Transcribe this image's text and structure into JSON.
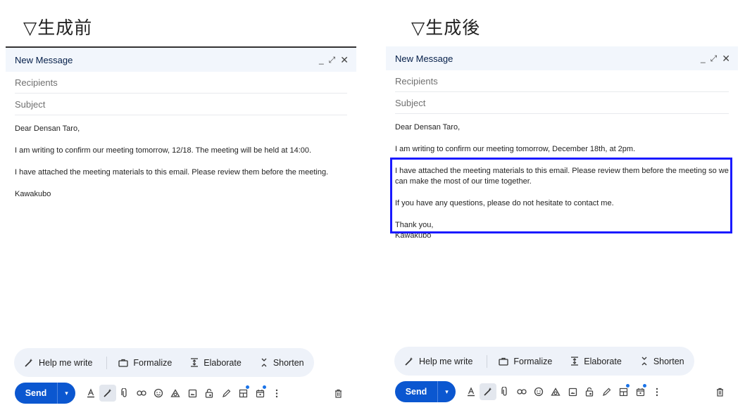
{
  "captions": {
    "before": "▽生成前",
    "after": "▽生成後"
  },
  "before": {
    "title": "New Message",
    "recipients_placeholder": "Recipients",
    "subject_placeholder": "Subject",
    "body": {
      "greeting": "Dear Densan Taro,",
      "para1": "I am writing to confirm our meeting tomorrow, 12/18. The meeting will be held at 14:00.",
      "para2": "I have attached the meeting materials to this email. Please review them before the meeting.",
      "signature": "Kawakubo"
    }
  },
  "after": {
    "title": "New Message",
    "recipients_placeholder": "Recipients",
    "subject_placeholder": "Subject",
    "body": {
      "greeting": "Dear Densan Taro,",
      "para1": "I am writing to confirm our meeting tomorrow, December 18th, at 2pm.",
      "para2": "I have attached the meeting materials to this email. Please review them before the meeting so we can make the most of our time together.",
      "para3": "If you have any questions, please do not hesitate to contact me.",
      "closing": "Thank you,",
      "signature": "Kawakubo"
    }
  },
  "window_controls": {
    "minimize": "_",
    "expand": "⤢",
    "close": "✕"
  },
  "ai_bar": {
    "help_me_write": "Help me write",
    "formalize": "Formalize",
    "elaborate": "Elaborate",
    "shorten": "Shorten"
  },
  "toolbar": {
    "send_label": "Send",
    "send_more": "▾"
  },
  "colors": {
    "send": "#0b57d0",
    "highlight": "#1a1aff",
    "titlebar": "#f2f6fc",
    "ai_bar": "#eef2f9"
  },
  "icons": [
    "formatting-icon",
    "ai-write-icon",
    "attach-icon",
    "link-icon",
    "emoji-icon",
    "drive-icon",
    "photo-icon",
    "confidential-icon",
    "signature-icon",
    "layout-icon",
    "schedule-icon",
    "more-options-icon",
    "trash-icon"
  ]
}
